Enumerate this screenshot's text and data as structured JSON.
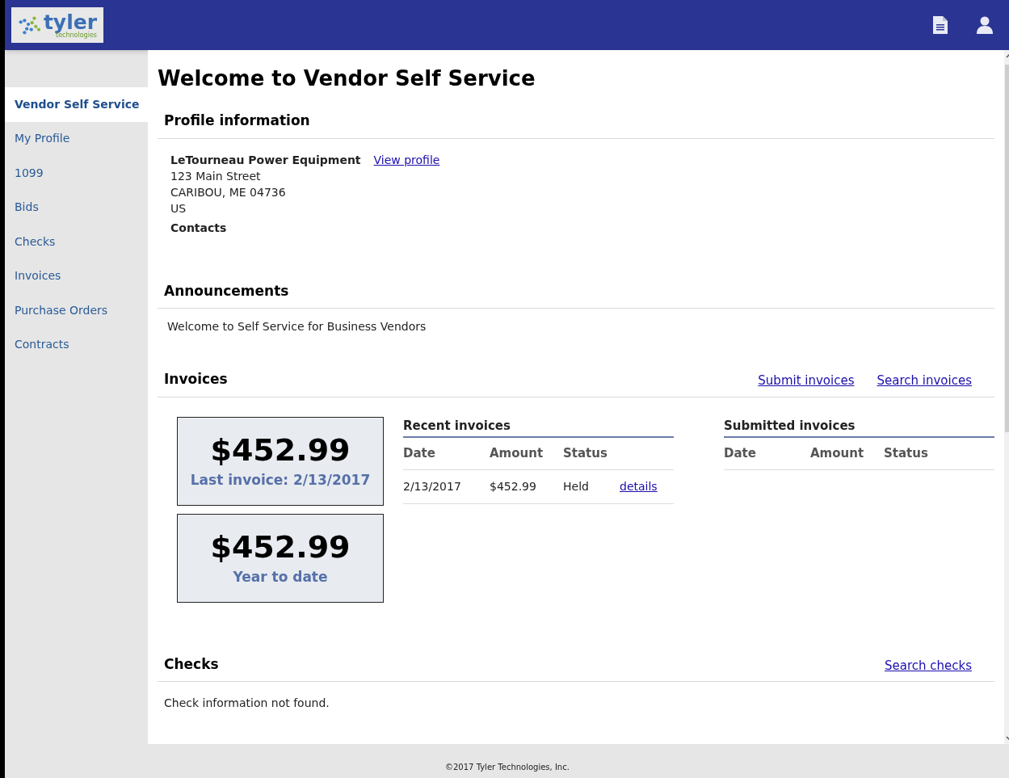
{
  "header": {
    "logo": {
      "name": "tyler",
      "tagline": "technologies"
    }
  },
  "sidebar": {
    "items": [
      {
        "label": "Vendor Self Service",
        "selected": true
      },
      {
        "label": "My Profile",
        "selected": false
      },
      {
        "label": "1099",
        "selected": false
      },
      {
        "label": "Bids",
        "selected": false
      },
      {
        "label": "Checks",
        "selected": false
      },
      {
        "label": "Invoices",
        "selected": false
      },
      {
        "label": "Purchase Orders",
        "selected": false
      },
      {
        "label": "Contracts",
        "selected": false
      }
    ]
  },
  "page_title": "Welcome to Vendor Self Service",
  "profile": {
    "heading": "Profile information",
    "name": "LeTourneau Power Equipment",
    "link": "View profile",
    "address": [
      "123 Main Street",
      "CARIBOU, ME 04736",
      "US"
    ],
    "contacts_label": "Contacts"
  },
  "announcements": {
    "heading": "Announcements",
    "text": "Welcome to Self Service for Business Vendors"
  },
  "invoices": {
    "heading": "Invoices",
    "links": [
      "Submit invoices",
      "Search invoices"
    ],
    "summary_cards": [
      {
        "amount": "$452.99",
        "label": "Last invoice: 2/13/2017"
      },
      {
        "amount": "$452.99",
        "label": "Year to date"
      }
    ],
    "recent": {
      "title": "Recent invoices",
      "columns": [
        "Date",
        "Amount",
        "Status"
      ],
      "rows": [
        {
          "date": "2/13/2017",
          "amount": "$452.99",
          "status": "Held",
          "link": "details"
        }
      ]
    },
    "submitted": {
      "title": "Submitted invoices",
      "columns": [
        "Date",
        "Amount",
        "Status"
      ]
    }
  },
  "checks": {
    "heading": "Checks",
    "links": [
      "Search checks"
    ],
    "text": "Check information not found."
  },
  "footer": "©2017 Tyler Technologies, Inc."
}
